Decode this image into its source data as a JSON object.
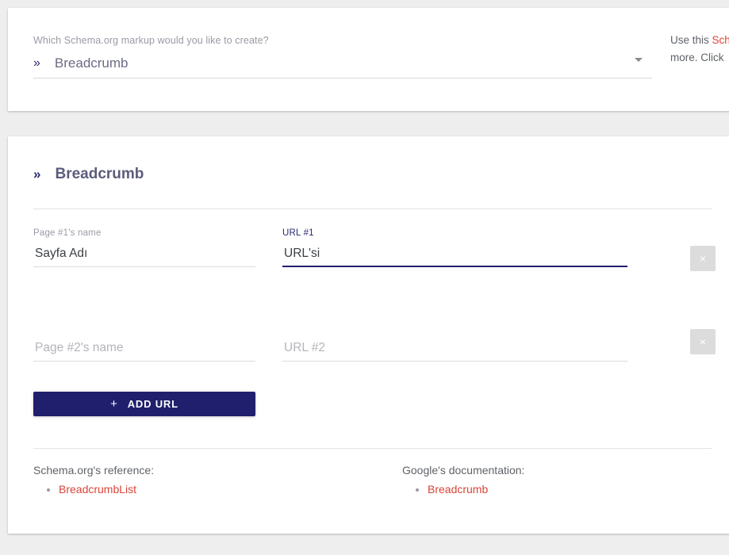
{
  "selector": {
    "label": "Which Schema.org markup would you like to create?",
    "chevron_glyph": "»",
    "value": "Breadcrumb"
  },
  "side_note": {
    "line1_prefix": "Use this ",
    "line1_link": "Sch",
    "line2": "more. Click"
  },
  "builder": {
    "chevron_glyph": "»",
    "title": "Breadcrumb",
    "rows": [
      {
        "name_label": "Page #1's name",
        "name_value": "Sayfa Adı",
        "name_placeholder": "Page #1's name",
        "url_label": "URL #1",
        "url_value": "URL'si",
        "url_placeholder": "URL #1",
        "remove_glyph": "×"
      },
      {
        "name_label": "Page #2's name",
        "name_value": "",
        "name_placeholder": "Page #2's name",
        "url_label": "URL #2",
        "url_value": "",
        "url_placeholder": "URL #2",
        "remove_glyph": "×"
      }
    ],
    "add_button": {
      "plus_glyph": "+",
      "label": "ADD URL"
    }
  },
  "references": {
    "schema": {
      "heading": "Schema.org's reference:",
      "link": "BreadcrumbList"
    },
    "google": {
      "heading": "Google's documentation:",
      "link": "Breadcrumb"
    }
  },
  "colors": {
    "accent_navy": "#1f1f6e",
    "link_red": "#db4437",
    "page_bg": "#eeeeee",
    "card_bg": "#ffffff",
    "muted_text": "#9a9aa5"
  }
}
